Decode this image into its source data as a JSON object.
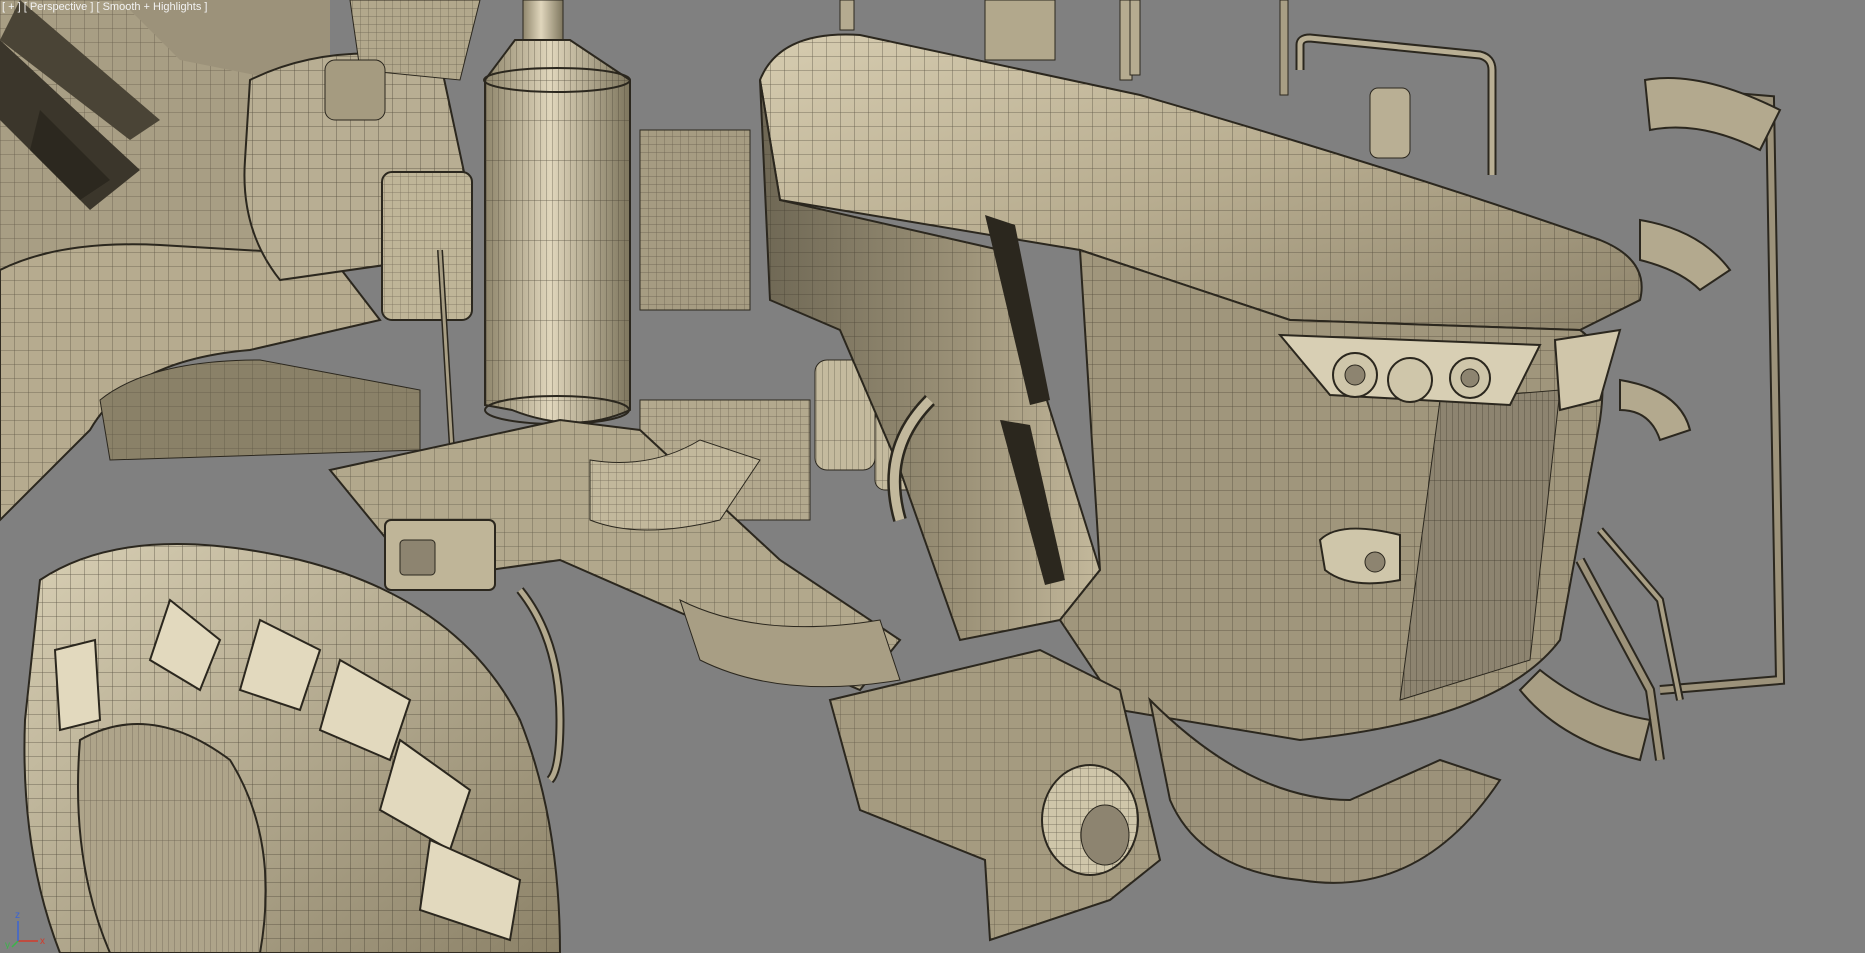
{
  "viewport": {
    "label_menu": "[ + ]",
    "label_view": "[ Perspective ]",
    "label_shading": "[ Smooth + Highlights ]",
    "background_color": "#808080",
    "model_color": "#c2b79b",
    "wire_color": "#2b271e"
  },
  "axis_gizmo": {
    "x_label": "x",
    "y_label": "y",
    "z_label": "z",
    "x_color": "#d43a2a",
    "y_color": "#3ab44a",
    "z_color": "#3a64d4"
  }
}
